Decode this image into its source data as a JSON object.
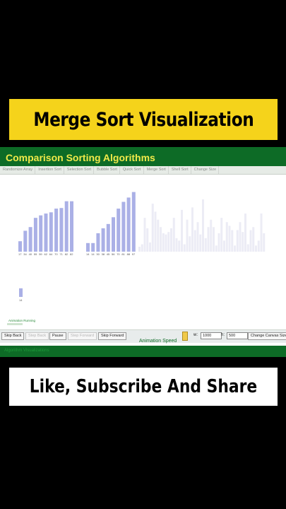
{
  "video": {
    "title_banner": "Merge Sort Visualization",
    "cta_banner": "Like, Subscribe And Share"
  },
  "app": {
    "title": "Comparison Sorting Algorithms",
    "menu": [
      "Randomize Array",
      "Insertion Sort",
      "Selection Sort",
      "Bubble Sort",
      "Quick Sort",
      "Merge Sort",
      "Shell Sort",
      "Change Size"
    ],
    "controls": {
      "skip_back": "Skip Back",
      "step_back": "Step Back",
      "pause": "Pause",
      "step_forward": "Step Forward",
      "skip_forward": "Skip Forward",
      "w_label": "w:",
      "w_value": "1000",
      "h_label": "h:",
      "h_value": "500",
      "change_canvas": "Change Canvas Size",
      "speed_label": "Animation Speed"
    },
    "running_label": "Animation Running",
    "footer_text": "Algorithm Visualizations"
  },
  "chart_data": {
    "type": "bar",
    "groups": [
      {
        "name": "left-sorted",
        "values": [
          17,
          34,
          40,
          55,
          59,
          62,
          64,
          70,
          71,
          82,
          82
        ],
        "labels": [
          "17",
          "34",
          "40",
          "55",
          "59",
          "62",
          "64",
          "70",
          "71",
          "82",
          "82"
        ],
        "color": "#aab0e6"
      },
      {
        "name": "right-sorted",
        "values": [
          14,
          14,
          30,
          38,
          45,
          56,
          70,
          81,
          88,
          97
        ],
        "labels": [
          "14",
          "14",
          "30",
          "38",
          "45",
          "56",
          "70",
          "81",
          "88",
          "97"
        ],
        "color": "#aab0e6"
      },
      {
        "name": "unsorted-faded",
        "values": [
          8,
          12,
          55,
          38,
          15,
          78,
          65,
          52,
          40,
          30,
          28,
          32,
          38,
          55,
          22,
          18,
          68,
          12,
          52,
          25,
          72,
          35,
          48,
          28,
          85,
          22,
          40,
          52,
          40,
          10,
          30,
          55,
          18,
          48,
          42,
          35,
          10,
          35,
          48,
          32,
          62,
          12,
          35,
          40,
          10,
          18,
          62,
          30
        ],
        "color": "#ececf5"
      }
    ],
    "temp": {
      "value": 14,
      "label": "14"
    }
  }
}
